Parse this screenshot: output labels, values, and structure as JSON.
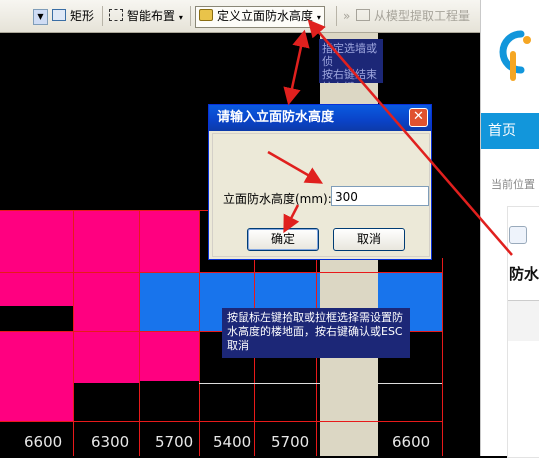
{
  "toolbar": {
    "rect_label": "矩形",
    "smart_layout_label": "智能布置",
    "define_waterproof_label": "定义立面防水高度",
    "extract_from_model_label": "从模型提取工程量"
  },
  "canvas": {
    "top_tooltip": "指定选墙或侦\n按右键结束\n按右键",
    "bottom_tooltip": "按鼠标左键拾取或拉框选择需设置防水高度的楼地面，按右键确认或ESC取消",
    "dimensions": [
      "6600",
      "6300",
      "5700",
      "5400",
      "5700",
      "6600"
    ]
  },
  "dialog": {
    "title": "请输入立面防水高度",
    "field_label": "立面防水高度(mm):",
    "field_value": "300",
    "ok_label": "确定",
    "cancel_label": "取消"
  },
  "right_panel": {
    "nav_home": "首页",
    "breadcrumb": "当前位置",
    "card_title": "防水"
  },
  "colors": {
    "pink": "#ff0080",
    "blue": "#1874ec",
    "grid": "#e81a1a",
    "annotation_arrow": "#e0201e",
    "nav": "#1296db"
  }
}
